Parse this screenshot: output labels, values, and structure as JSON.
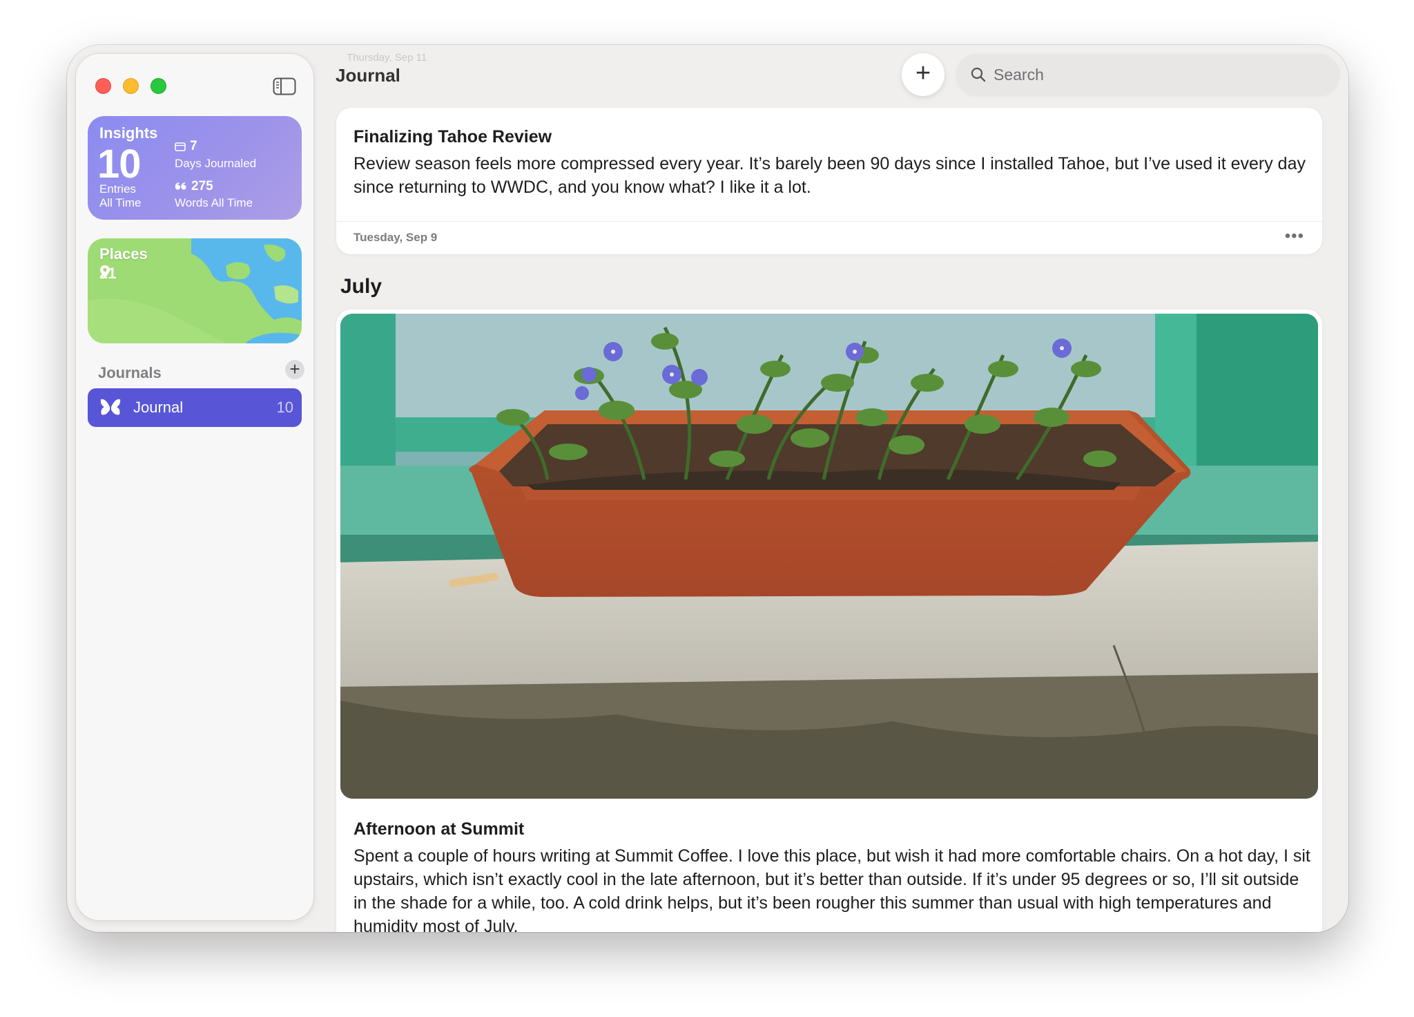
{
  "sidebar": {
    "insights": {
      "title": "Insights",
      "entries_count": "10",
      "entries_label_1": "Entries",
      "entries_label_2": "All Time",
      "days_count": "7",
      "days_label": "Days Journaled",
      "words_count": "275",
      "words_label": "Words All Time"
    },
    "places": {
      "title": "Places",
      "count": "21"
    },
    "journals_header": "Journals",
    "add_journal_label": "+",
    "journals": [
      {
        "label": "Journal",
        "count": "10",
        "color": "#5856d6"
      }
    ]
  },
  "header": {
    "title": "Journal",
    "ghost_date": "Thursday, Sep 11",
    "add_label": "+",
    "search_placeholder": "Search"
  },
  "entries": [
    {
      "title": "Finalizing Tahoe Review",
      "body": "Review season feels more compressed every year. It’s barely been 90 days since I installed Tahoe, but I’ve used it every day since returning to WWDC, and you know what? I like it a lot.",
      "date": "Tuesday, Sep 9",
      "more_label": "•••"
    }
  ],
  "sections": [
    {
      "heading": "July",
      "entry": {
        "title": "Afternoon at Summit",
        "body": "Spent a couple of hours writing at Summit Coffee. I love this place, but wish it had more comfortable chairs. On a hot day, I sit upstairs, which isn’t exactly cool in the late afternoon, but it’s better than outside. If it’s under 95 degrees or so, I’ll sit outside in the shade for a while, too. A cold drink helps, but it’s been rougher this summer than usual with high temperatures and humidity most of July."
      }
    }
  ],
  "colors": {
    "accent": "#5856d6",
    "insights_gradient_start": "#8b8cf0",
    "insights_gradient_end": "#ad9ee6",
    "places_green": "#9edb74",
    "places_water": "#58b8ec"
  }
}
